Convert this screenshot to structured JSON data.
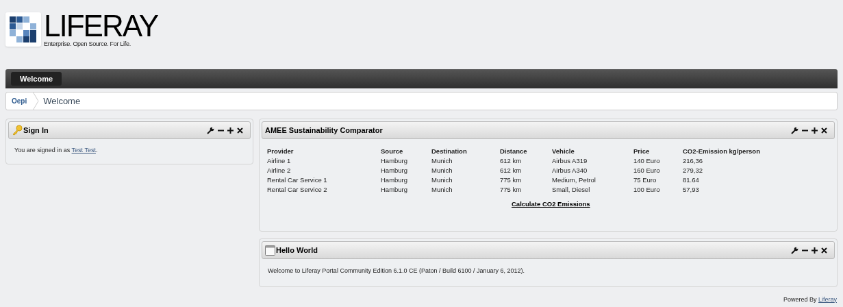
{
  "logo": {
    "name": "LIFERAY",
    "tagline": "Enterprise. Open Source. For Life."
  },
  "nav": {
    "items": [
      {
        "label": "Welcome",
        "selected": true
      }
    ]
  },
  "breadcrumb": [
    {
      "label": "Oepi"
    },
    {
      "label": "Welcome"
    }
  ],
  "sign_in": {
    "title": "Sign In",
    "text_before": "You are signed in as ",
    "link": "Test Test",
    "text_after": "."
  },
  "comparator": {
    "title": "AMEE Sustainability Comparator",
    "columns": [
      "Provider",
      "Source",
      "Destination",
      "Distance",
      "Vehicle",
      "Price",
      "CO2-Emission kg/person"
    ],
    "rows": [
      [
        "Airline 1",
        "Hamburg",
        "Munich",
        "612 km",
        "Airbus A319",
        "140 Euro",
        "216,36"
      ],
      [
        "Airline 2",
        "Hamburg",
        "Munich",
        "612 km",
        "Airbus A340",
        "160 Euro",
        "279,32"
      ],
      [
        "Rental Car Service 1",
        "Hamburg",
        "Munich",
        "775 km",
        "Medium, Petrol",
        "75 Euro",
        "81.64"
      ],
      [
        "Rental Car Service 2",
        "Hamburg",
        "Munich",
        "775 km",
        "Small, Diesel",
        "100 Euro",
        "57,93"
      ]
    ],
    "action": "Calculate CO2 Emissions"
  },
  "hello_world": {
    "title": "Hello World",
    "text": "Welcome to Liferay Portal Community Edition 6.1.0 CE (Paton / Build 6100 / January 6, 2012)."
  },
  "footer": {
    "text": "Powered By ",
    "link": "Liferay"
  }
}
